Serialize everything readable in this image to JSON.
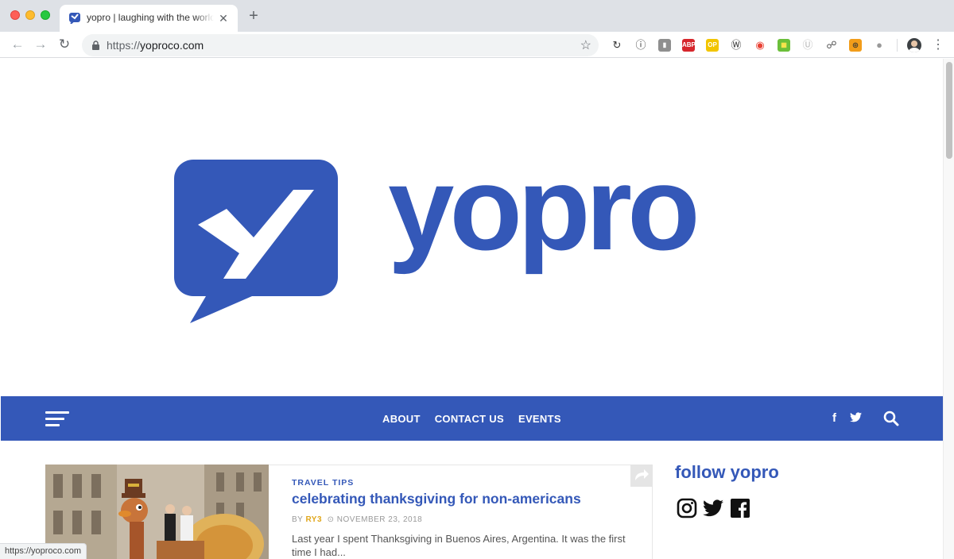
{
  "browser": {
    "tab_title": "yopro | laughing with the world",
    "tab_close": "✕",
    "new_tab": "+",
    "url_scheme": "https://",
    "url_host": "yoproco.com",
    "status_url": "https://yoproco.com",
    "extensions": [
      {
        "name": "sync-icon",
        "color": "#ffffff",
        "fg": "#333333",
        "glyph": "↻"
      },
      {
        "name": "info-icon",
        "color": "#ffffff",
        "fg": "#333333",
        "glyph": "ⓘ"
      },
      {
        "name": "stats-icon",
        "color": "#8f8f8f",
        "fg": "#ffffff",
        "glyph": "▮"
      },
      {
        "name": "adblock-icon",
        "color": "#d6262c",
        "fg": "#ffffff",
        "glyph": "ABP"
      },
      {
        "name": "op-icon",
        "color": "#f2c500",
        "fg": "#ffffff",
        "glyph": "OP"
      },
      {
        "name": "w-icon",
        "color": "#ffffff",
        "fg": "#333333",
        "glyph": "Ⓦ"
      },
      {
        "name": "color-wheel-icon",
        "color": "#ffffff",
        "fg": "#e94235",
        "glyph": "◉"
      },
      {
        "name": "map-icon",
        "color": "#6bbf3a",
        "fg": "#ffe64d",
        "glyph": "▦"
      },
      {
        "name": "u-icon",
        "color": "#ffffff",
        "fg": "#bbbbbb",
        "glyph": "Ⓤ"
      },
      {
        "name": "leaf-icon",
        "color": "#ffffff",
        "fg": "#555555",
        "glyph": "☍"
      },
      {
        "name": "eye-icon",
        "color": "#f29d1a",
        "fg": "#333333",
        "glyph": "◎"
      },
      {
        "name": "circle-icon",
        "color": "#ffffff",
        "fg": "#999999",
        "glyph": "●"
      }
    ]
  },
  "site": {
    "logo_word": "yopro",
    "brand_color": "#3458b8",
    "nav": {
      "links": [
        "ABOUT",
        "CONTACT US",
        "EVENTS"
      ],
      "facebook": "f",
      "twitter_icon": "twitter-icon"
    },
    "post": {
      "category": "TRAVEL TIPS",
      "title": "celebrating thanksgiving for non-americans",
      "by": "BY",
      "author": "RY3",
      "date": "NOVEMBER 23, 2018",
      "excerpt": "Last year I spent Thanksgiving in Buenos Aires, Argentina. It was the first time I had..."
    },
    "sidebar": {
      "title": "follow yopro"
    }
  }
}
